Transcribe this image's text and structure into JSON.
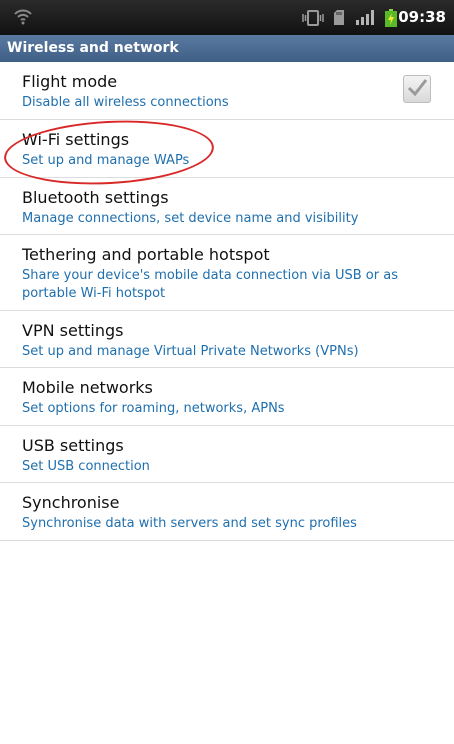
{
  "status_bar": {
    "time": "09:38",
    "icons": [
      "wifi-icon",
      "vibrate-icon",
      "sd-card-icon",
      "signal-icon",
      "battery-charging-icon"
    ]
  },
  "section": {
    "title": "Wireless and network"
  },
  "items": [
    {
      "title": "Flight mode",
      "summary": "Disable all wireless connections",
      "checked": true
    },
    {
      "title": "Wi-Fi settings",
      "summary": "Set up and manage WAPs"
    },
    {
      "title": "Bluetooth settings",
      "summary": "Manage connections, set device name and visibility"
    },
    {
      "title": "Tethering and portable hotspot",
      "summary": "Share your device's mobile data connection via USB or as",
      "summary_line2": "portable Wi-Fi hotspot"
    },
    {
      "title": "VPN settings",
      "summary": "Set up and manage Virtual Private Networks (VPNs)"
    },
    {
      "title": "Mobile networks",
      "summary": "Set options for roaming, networks, APNs"
    },
    {
      "title": "USB settings",
      "summary": "Set USB connection"
    },
    {
      "title": "Synchronise",
      "summary": "Synchronise data with servers and set sync profiles"
    }
  ],
  "colors": {
    "accent": "#1f6fae",
    "header": "#4a6b93",
    "highlight": "#d82828"
  }
}
